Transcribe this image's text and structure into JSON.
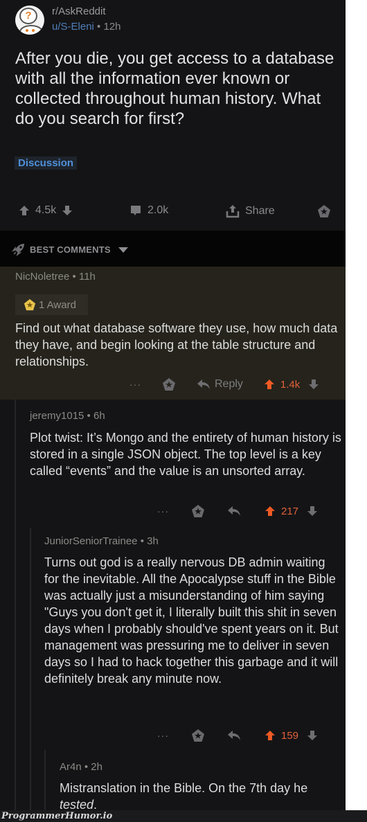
{
  "post": {
    "subreddit": "r/AskReddit",
    "author": "u/S-Eleni",
    "separator": "•",
    "age": "12h",
    "title": "After you die, you get access to a database with all the information ever known or collected throughout human history. What do you search for first?",
    "flair": "Discussion",
    "score": "4.5k",
    "comments": "2.0k",
    "share_label": "Share"
  },
  "sort": {
    "label": "BEST COMMENTS"
  },
  "comments": [
    {
      "author": "NicNoletree",
      "age": "11h",
      "award_label": "1 Award",
      "body": "Find out what database software they use, how much data they have, and begin looking at the table structure and relationships.",
      "more": "···",
      "reply_label": "Reply",
      "score": "1.4k",
      "depth": 0
    },
    {
      "author": "jeremy1015",
      "age": "6h",
      "body": "Plot twist: It’s Mongo and the entirety of human history is stored in a single JSON object. The top level is a key called “events” and the value is an unsorted array.",
      "more": "···",
      "score": "217",
      "depth": 1
    },
    {
      "author": "JuniorSeniorTrainee",
      "age": "3h",
      "body": "Turns out god is a really nervous DB admin waiting for the inevitable. All the Apocalypse stuff in the Bible was actually just a misunderstanding of him saying \"Guys you don't get it, I literally built this shit in seven days when I probably should've spent years on it. But management was pressuring me to deliver in seven days so I had to hack together this garbage and it will definitely break any minute now.",
      "more": "···",
      "score": "159",
      "depth": 2
    },
    {
      "author": "Ar4n",
      "age": "2h",
      "body_prefix": "Mistranslation in the Bible. On the 7th day he ",
      "body_emph": "tested",
      "body_suffix": ".",
      "depth": 3
    }
  ],
  "watermark": "ProgrammerHumor.io",
  "colors": {
    "upvote_active": "#ee5a24",
    "link_blue": "#4f7fb8",
    "flair_blue": "#4f8fd8",
    "highlight_bg": "#25231b"
  }
}
